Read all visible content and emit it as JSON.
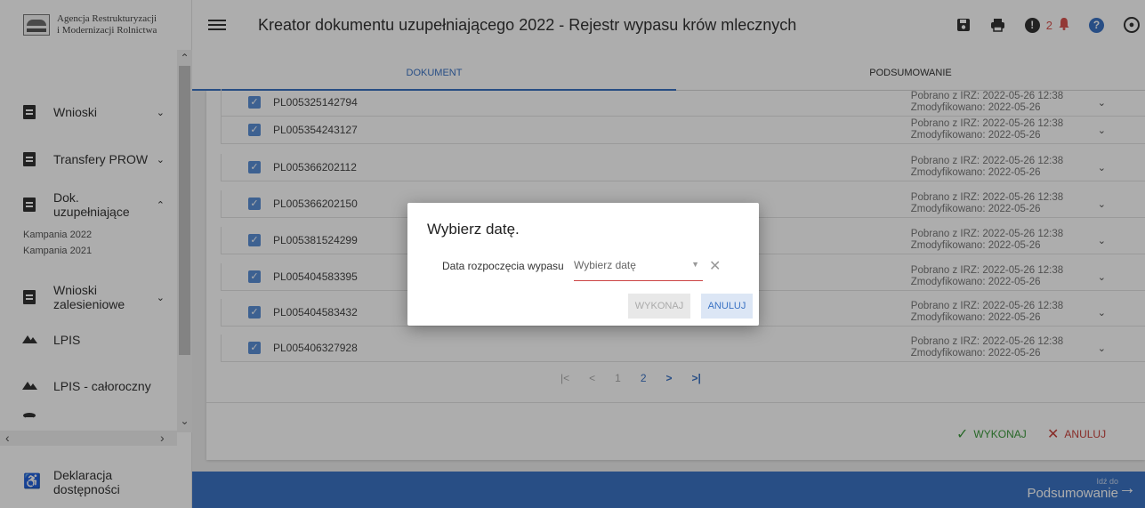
{
  "logo": {
    "line1": "Agencja Restrukturyzacji",
    "line2": "i Modernizacji Rolnictwa"
  },
  "sidebar": {
    "items": [
      {
        "label": "Wnioski",
        "chevron": "⌵"
      },
      {
        "label": "Transfery PROW",
        "chevron": "⌵"
      },
      {
        "label": "Dok. uzupełniające",
        "chevron": "^"
      },
      {
        "label": "Wnioski zalesieniowe",
        "chevron": "⌵"
      },
      {
        "label": "LPIS",
        "chevron": ""
      },
      {
        "label": "LPIS - całoroczny",
        "chevron": ""
      },
      {
        "label": "Deklaracja dostępności",
        "chevron": ""
      }
    ],
    "subitems": [
      "Kampania 2022",
      "Kampania 2021"
    ]
  },
  "header": {
    "title": "Kreator dokumentu uzupełniającego 2022 - Rejestr wypasu krów mlecznych",
    "notification_count": "2"
  },
  "tabs": [
    "DOKUMENT",
    "PODSUMOWANIE"
  ],
  "rows": [
    {
      "id": "PL005325142794",
      "meta1": "Pobrano z IRZ: 2022-05-26 12:38",
      "meta2": "Zmodyfikowano: 2022-05-26"
    },
    {
      "id": "PL005354243127",
      "meta1": "Pobrano z IRZ: 2022-05-26 12:38",
      "meta2": "Zmodyfikowano: 2022-05-26"
    },
    {
      "id": "PL005366202112",
      "meta1": "Pobrano z IRZ: 2022-05-26 12:38",
      "meta2": "Zmodyfikowano: 2022-05-26"
    },
    {
      "id": "PL005366202150",
      "meta1": "Pobrano z IRZ: 2022-05-26 12:38",
      "meta2": "Zmodyfikowano: 2022-05-26"
    },
    {
      "id": "PL005381524299",
      "meta1": "Pobrano z IRZ: 2022-05-26 12:38",
      "meta2": "Zmodyfikowano: 2022-05-26"
    },
    {
      "id": "PL005404583395",
      "meta1": "Pobrano z IRZ: 2022-05-26 12:38",
      "meta2": "Zmodyfikowano: 2022-05-26"
    },
    {
      "id": "PL005404583432",
      "meta1": "Pobrano z IRZ: 2022-05-26 12:38",
      "meta2": "Zmodyfikowano: 2022-05-26"
    },
    {
      "id": "PL005406327928",
      "meta1": "Pobrano z IRZ: 2022-05-26 12:38",
      "meta2": "Zmodyfikowano: 2022-05-26"
    }
  ],
  "pagination": {
    "first": "|<",
    "prev": "<",
    "page1": "1",
    "page2": "2",
    "next": ">",
    "last": ">|",
    "current": "2"
  },
  "actions": {
    "ok": "WYKONAJ",
    "cancel": "ANULUJ"
  },
  "bottom": {
    "small": "Idź do",
    "big": "Podsumowanie"
  },
  "dialog": {
    "title": "Wybierz datę.",
    "field_label": "Data rozpoczęcia wypasu",
    "select_placeholder": "Wybierz datę",
    "ok": "WYKONAJ",
    "cancel": "ANULUJ"
  },
  "colors": {
    "accent": "#3b73c4",
    "ok": "#3c9a3c",
    "cancel": "#c9423c",
    "alert": "#d9534f"
  },
  "icons": [
    "hamburger-icon",
    "save-icon",
    "print-icon",
    "alert-icon",
    "bell-icon",
    "help-icon",
    "user-icon",
    "checkbox-icon",
    "chevron-down-icon",
    "arrow-right-icon",
    "clear-icon"
  ]
}
